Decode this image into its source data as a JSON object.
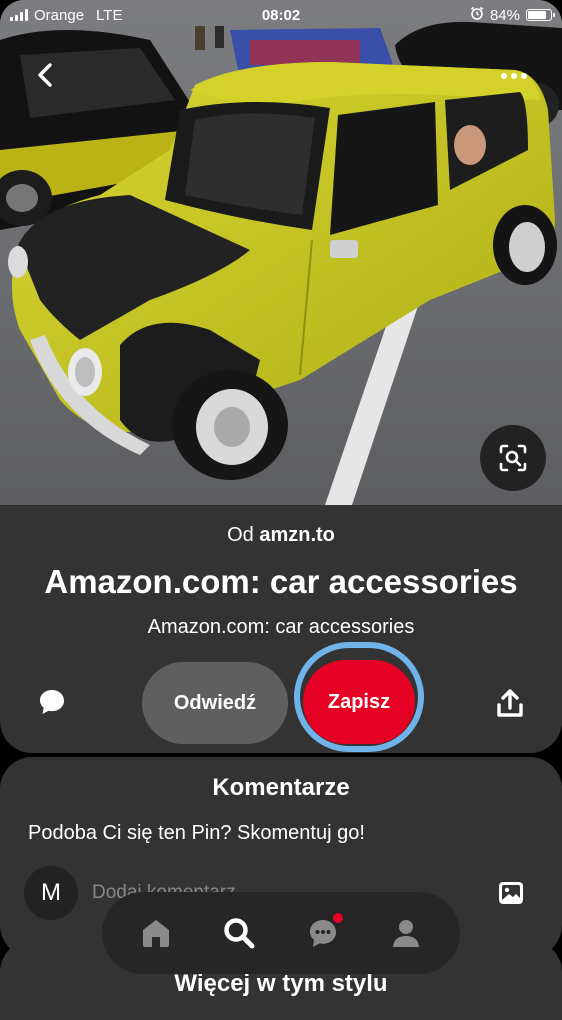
{
  "status_bar": {
    "carrier": "Orange",
    "network": "LTE",
    "time": "08:02",
    "battery_percent": "84%",
    "battery_level": 0.84
  },
  "pin_image": {
    "subject": "yellow classic car with black hood"
  },
  "pin": {
    "source_prefix": "Od",
    "source_domain": "amzn.to",
    "title": "Amazon.com: car accessories",
    "description": "Amazon.com: car accessories"
  },
  "actions": {
    "visit_label": "Odwiedź",
    "save_label": "Zapisz"
  },
  "comments": {
    "title": "Komentarze",
    "prompt": "Podoba Ci się ten Pin? Skomentuj go!",
    "avatar_initial": "M",
    "input_placeholder": "Dodaj komentarz"
  },
  "more_like_this": {
    "title": "Więcej w tym stylu"
  },
  "nav": {
    "items": [
      "home-icon",
      "search-icon",
      "messages-icon",
      "profile-icon"
    ],
    "has_notification": true
  },
  "colors": {
    "save_red": "#e60023",
    "focus_ring": "#6fb3e8",
    "card_bg": "#333333",
    "car_yellow": "#c8c81e"
  }
}
